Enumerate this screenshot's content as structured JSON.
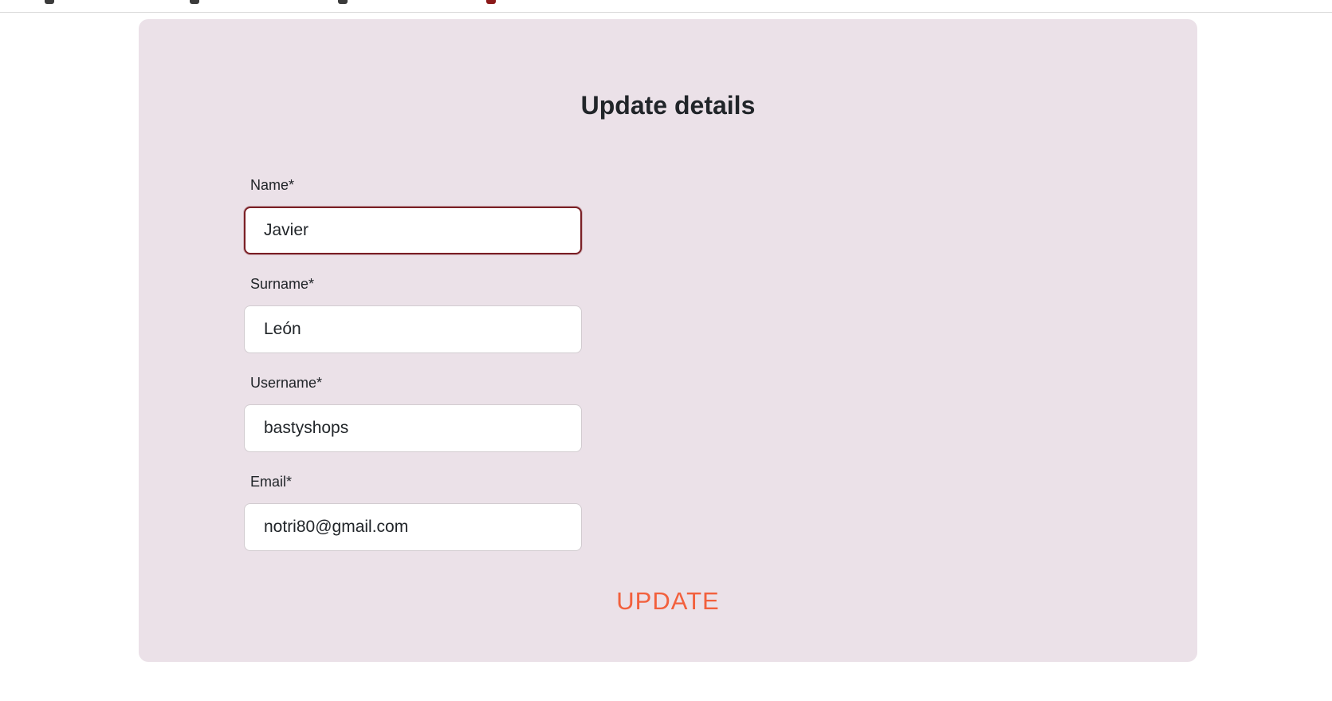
{
  "form": {
    "title": "Update details",
    "fields": [
      {
        "label": "Name*",
        "value": "Javier",
        "focused": true
      },
      {
        "label": "Surname*",
        "value": "León"
      },
      {
        "label": "Username*",
        "value": "bastyshops"
      },
      {
        "label": "Email*",
        "value": "notri80@gmail.com"
      }
    ],
    "submit_label": "UPDATE"
  },
  "colors": {
    "page_background": "#ffffff",
    "card_background": "#ebe1e8",
    "focus_border": "#7a1f25",
    "accent": "#f2603d",
    "text": "#212529"
  }
}
